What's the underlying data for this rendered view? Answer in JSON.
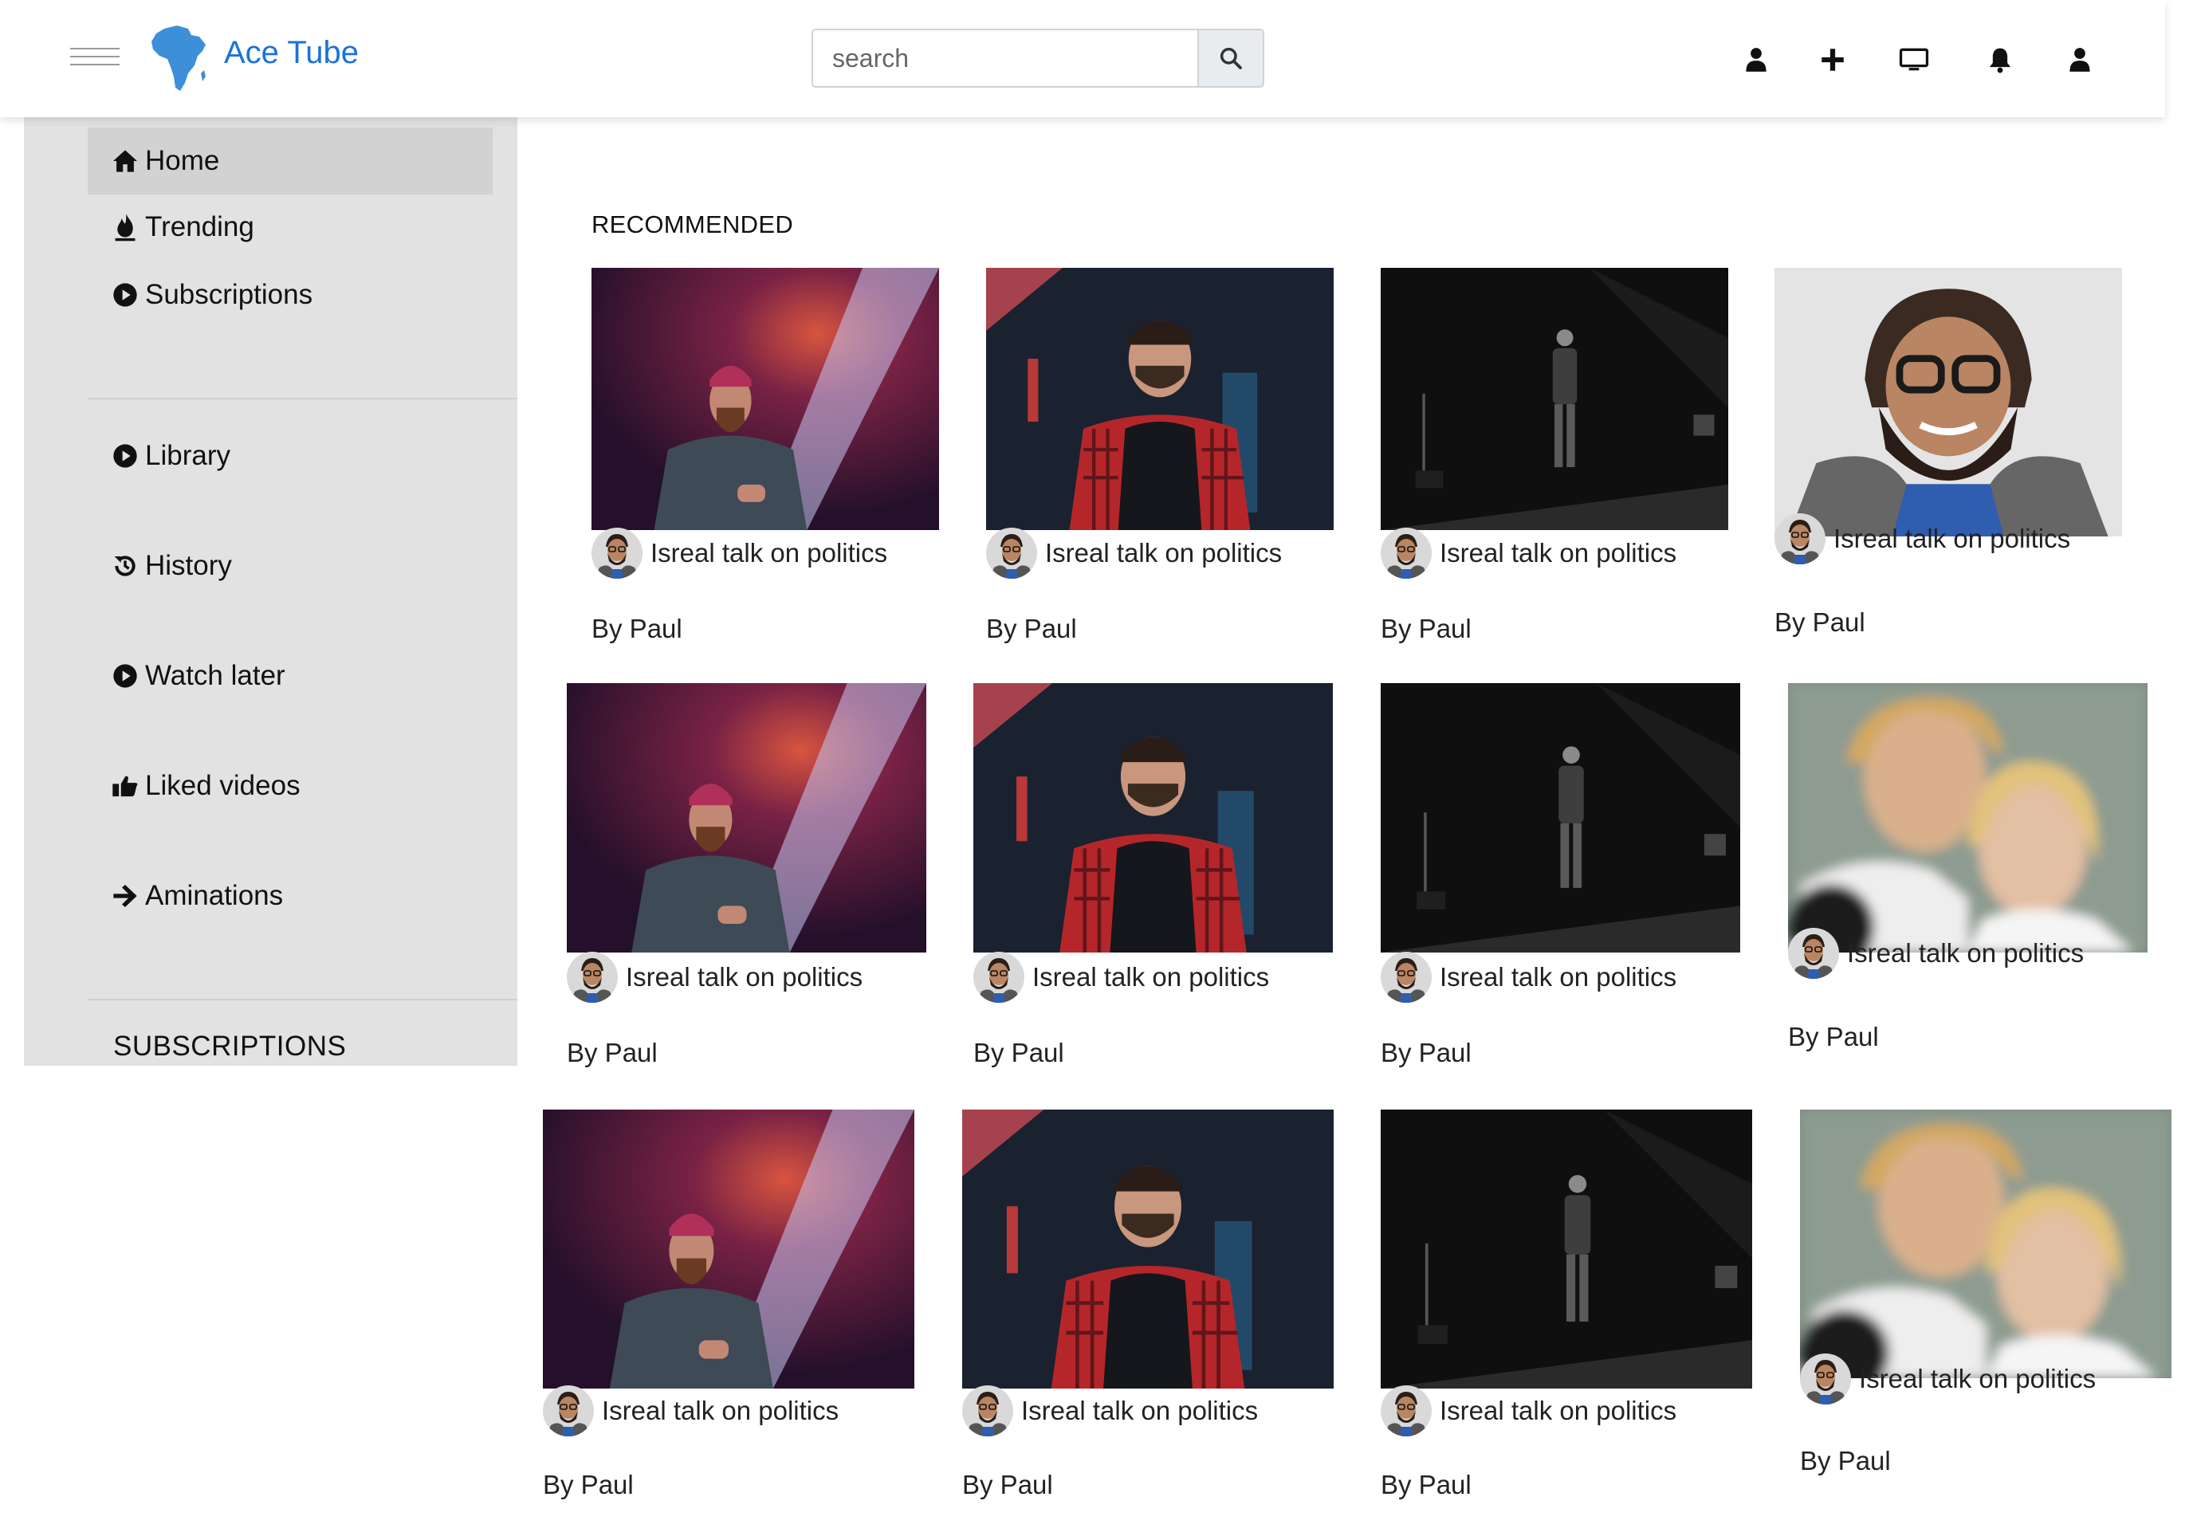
{
  "header": {
    "brand": "Ace Tube",
    "search_placeholder": "search",
    "icons": [
      "user-icon",
      "plus-icon",
      "monitor-icon",
      "bell-icon",
      "user-icon"
    ]
  },
  "colors": {
    "brand": "#1a73d9",
    "sidebar_bg": "#e2e2e2",
    "active_item_bg": "#d2d2d2"
  },
  "sidebar": {
    "items": [
      {
        "label": "Home",
        "icon": "home-icon"
      },
      {
        "label": "Trending",
        "icon": "fire-icon"
      },
      {
        "label": "Subscriptions",
        "icon": "play-circle-icon"
      },
      {
        "label": "Library",
        "icon": "play-circle-icon"
      },
      {
        "label": "History",
        "icon": "history-icon"
      },
      {
        "label": "Watch later",
        "icon": "play-circle-icon"
      },
      {
        "label": "Liked videos",
        "icon": "thumbs-up-icon"
      },
      {
        "label": "Aminations",
        "icon": "arrow-right-icon"
      }
    ],
    "subscriptions_heading": "SUBSCRIPTIONS"
  },
  "main": {
    "section_title": "RECOMMENDED",
    "videos": [
      {
        "title": "Isreal talk on politics",
        "author": "By Paul",
        "thumb": "stage-speaker"
      },
      {
        "title": "Isreal talk on politics",
        "author": "By Paul",
        "thumb": "flannel-portrait"
      },
      {
        "title": "Isreal talk on politics",
        "author": "By Paul",
        "thumb": "dark-stage"
      },
      {
        "title": "Isreal talk on politics",
        "author": "By Paul",
        "thumb": "bearded-glasses"
      },
      {
        "title": "Isreal talk on politics",
        "author": "By Paul",
        "thumb": "stage-speaker"
      },
      {
        "title": "Isreal talk on politics",
        "author": "By Paul",
        "thumb": "flannel-portrait"
      },
      {
        "title": "Isreal talk on politics",
        "author": "By Paul",
        "thumb": "dark-stage"
      },
      {
        "title": "Isreal talk on politics",
        "author": "By Paul",
        "thumb": "couple-blur"
      },
      {
        "title": "Isreal talk on politics",
        "author": "By Paul",
        "thumb": "stage-speaker"
      },
      {
        "title": "Isreal talk on politics",
        "author": "By Paul",
        "thumb": "flannel-portrait"
      },
      {
        "title": "Isreal talk on politics",
        "author": "By Paul",
        "thumb": "dark-stage"
      },
      {
        "title": "Isreal talk on politics",
        "author": "By Paul",
        "thumb": "couple-blur"
      }
    ]
  }
}
